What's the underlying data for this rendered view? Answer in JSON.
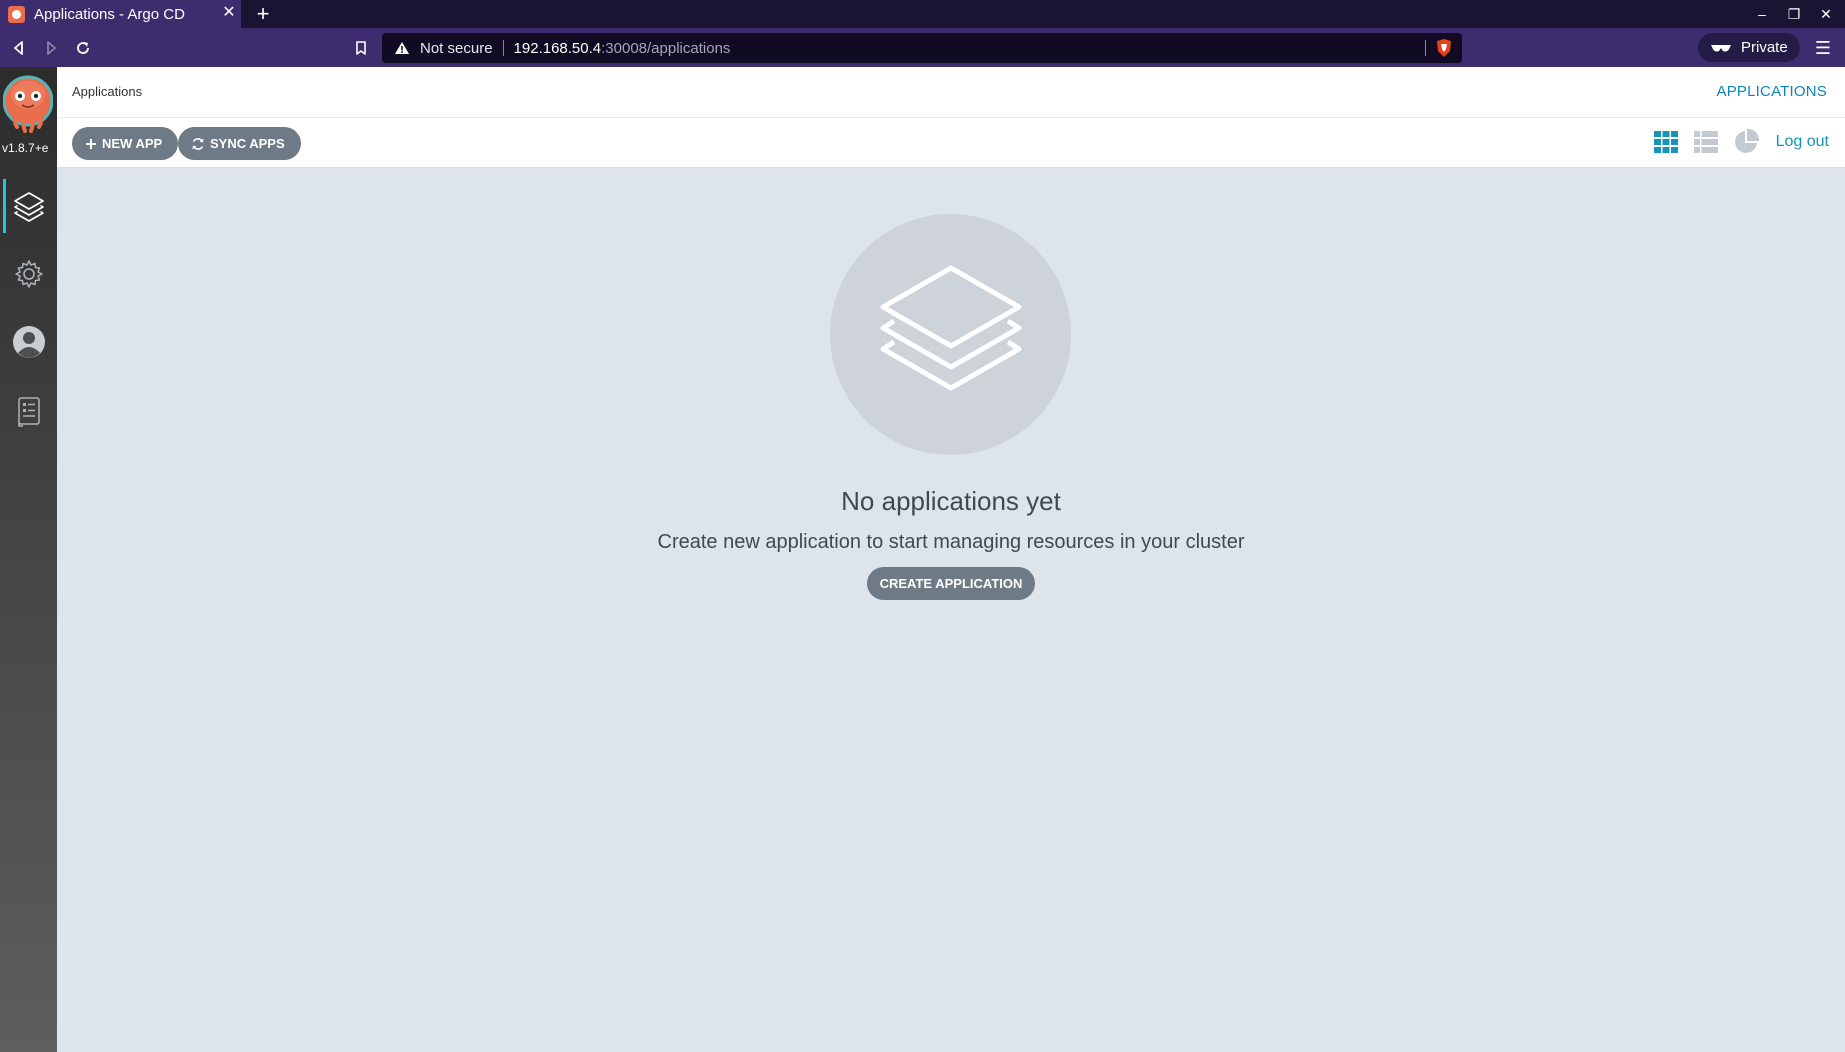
{
  "browser": {
    "tab_title": "Applications - Argo CD",
    "tab_close": "✕",
    "new_tab": "+",
    "security_label": "Not secure",
    "url_host": "192.168.50.4",
    "url_rest": ":30008/applications",
    "private_label": "Private",
    "window_minimize": "–",
    "window_restore": "❐",
    "window_close": "✕",
    "menu": "☰"
  },
  "sidebar": {
    "version": "v1.8.7+e",
    "items": [
      {
        "icon": "layers-icon",
        "active": true
      },
      {
        "icon": "gear-icon",
        "active": false
      },
      {
        "icon": "user-icon",
        "active": false
      },
      {
        "icon": "docs-icon",
        "active": false
      }
    ],
    "accent": "#21c9d6"
  },
  "header": {
    "breadcrumb": "Applications",
    "title": "APPLICATIONS"
  },
  "actions": {
    "new_app": "NEW APP",
    "sync_apps": "SYNC APPS",
    "logout": "Log out",
    "views": [
      "tiles-view-icon",
      "list-view-icon",
      "summary-view-icon"
    ]
  },
  "empty_state": {
    "icon": "layers-icon",
    "title": "No applications yet",
    "subtitle": "Create new application to start managing resources in your cluster",
    "button": "CREATE APPLICATION"
  },
  "colors": {
    "browser_bg": "#3d2c6e",
    "content_bg": "#dee4eb",
    "button": "#6e7b87",
    "link": "#1795b8"
  }
}
